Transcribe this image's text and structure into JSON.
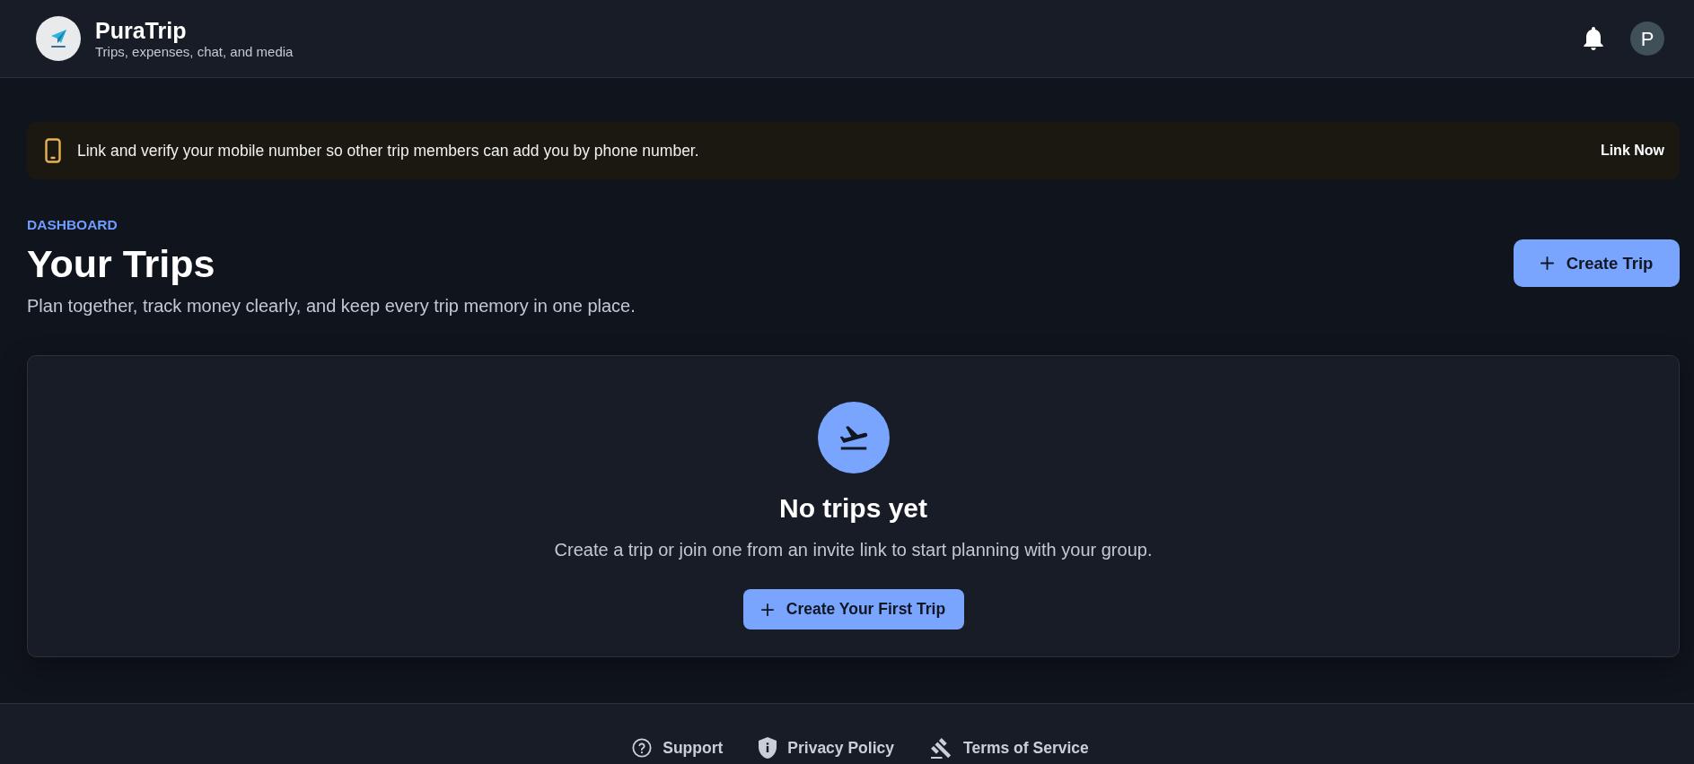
{
  "header": {
    "app_name": "PuraTrip",
    "tagline": "Trips, expenses, chat, and media",
    "avatar_initial": "P"
  },
  "banner": {
    "message": "Link and verify your mobile number so other trip members can add you by phone number.",
    "action": "Link Now"
  },
  "page": {
    "eyebrow": "DASHBOARD",
    "title": "Your Trips",
    "subtitle": "Plan together, track money clearly, and keep every trip memory in one place.",
    "primary_action": "Create Trip"
  },
  "empty_state": {
    "title": "No trips yet",
    "description": "Create a trip or join one from an invite link to start planning with your group.",
    "action": "Create Your First Trip"
  },
  "footer": {
    "links": [
      {
        "kind": "support",
        "label": "Support"
      },
      {
        "kind": "privacy",
        "label": "Privacy Policy"
      },
      {
        "kind": "terms",
        "label": "Terms of Service"
      }
    ]
  }
}
